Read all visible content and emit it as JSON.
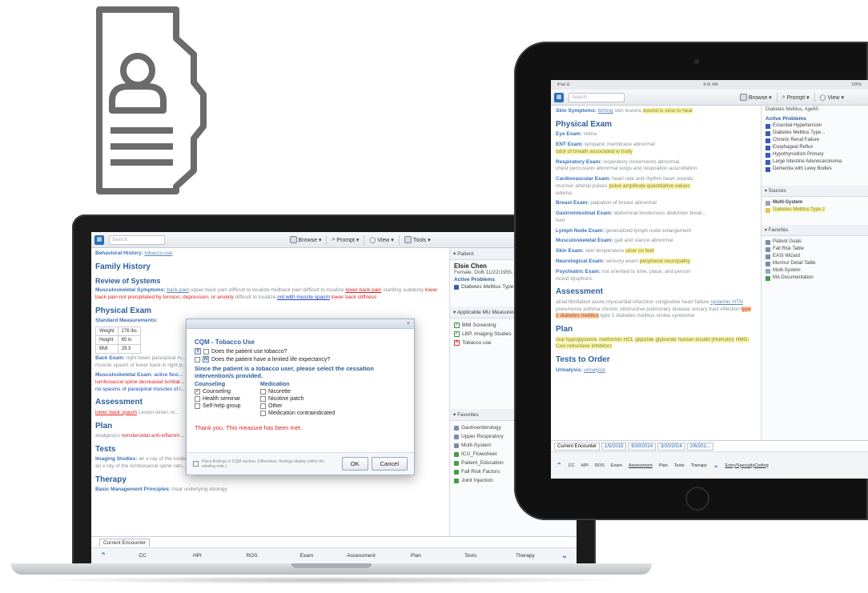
{
  "toolbar": {
    "search_placeholder": "Search",
    "browse": "Browse ▾",
    "prompt": "Prompt ▾",
    "view": "View ▾",
    "tools": "Tools ▾"
  },
  "laptop": {
    "behavioral_label": "Behavioral History:",
    "behavioral_value": "tobacco use",
    "family_history": "Family History",
    "review_of_systems": "Review of Systems",
    "ros_label": "Musculoskeletal Symptoms:",
    "ros_text_1": "back pain",
    "ros_text_2": "upper back pain difficult to localize",
    "ros_text_3": "midback pain difficult to localize",
    "ros_text_4": "lower back pain",
    "ros_text_5": "startling suddenly",
    "ros_text_6": "lower back pain not precipitated by tension, depression, or anxiety",
    "ros_text_7": "difficult to localize",
    "ros_text_8": "not with muscle spasm",
    "ros_text_9": "lower back stiffness",
    "physical_exam": "Physical Exam",
    "standard_measurements": "Standard Measurements:",
    "vitals": [
      {
        "label": "Weight",
        "value": "176 lbs"
      },
      {
        "label": "Height",
        "value": "65 in"
      },
      {
        "label": "BMI",
        "value": "29.3"
      }
    ],
    "back_exam_label": "Back Exam:",
    "back_exam_text": "right lower paraspinal m...",
    "back_exam_text2": "muscle spasm of lower back in right p...",
    "msk_label": "Musculoskeletal Exam:",
    "msk_text": "active flexi...",
    "msk_text2": "lumbosacral spine decreased lumbar...",
    "msk_text3": "no spasms of paraspinal muscles of l...",
    "assessment": "Assessment",
    "assessment_text": "lower back spasm",
    "assessment_text2": "Lesion strain, lo...",
    "plan": "Plan",
    "plan_text": "analgesics",
    "plan_text2": "nonsteroidal anti-inflamm...",
    "tests": "Tests",
    "imaging_label": "Imaging Studies:",
    "imaging_text": "an x-ray of the lumbosacral spine (AP, lateral, and oblique views)",
    "imaging_text2": "an x-ray of the lumbosacral spine can...",
    "therapy": "Therapy",
    "therapy_label": "Basic Management Principles:",
    "therapy_text": "treat underlying etiology",
    "tab_label": "Current Encounter",
    "nav": [
      "CC",
      "HPI",
      "ROS",
      "Exam",
      "Assessment",
      "Plan",
      "Tests",
      "Therapy"
    ],
    "right": {
      "patient_header": "▾ Patient",
      "patient_name": "Elsie Chen",
      "patient_info": "Female, DoB 11/22/1955, ...",
      "active_problems": "Active Problems",
      "problem_1": "Diabetes Mellitus Type...",
      "mu_header": "▾ Applicable MU Measures",
      "mu_items": [
        "BMI Screening",
        "LBP, Imaging Studies",
        "Tobacco use"
      ],
      "fav_header": "▾ Favorites",
      "favorites": [
        "Gastroenterology",
        "Upper Respiratory",
        "Multi-System",
        "ICU_Flowsheet",
        "Patient_Education",
        "Fall Risk Factors",
        "Joint Injection"
      ]
    }
  },
  "dialog": {
    "close": "×",
    "title": "CQM - Tobacco Use",
    "q1_answer": "Y",
    "q1": "Does the patient use tobacco?",
    "q2_answer": "N",
    "q2": "Does the patient have a limited life expectancy?",
    "instruction": "Since the patient is a tobacco user, please select the cessation intervention/s provided.",
    "counseling_header": "Counseling",
    "counseling": [
      {
        "label": "Counseling",
        "checked": true
      },
      {
        "label": "Health seminar",
        "checked": false
      },
      {
        "label": "Self-help group",
        "checked": false
      }
    ],
    "medication_header": "Medication",
    "medication": [
      {
        "label": "Nicorette",
        "checked": false
      },
      {
        "label": "Nicotine patch",
        "checked": false
      },
      {
        "label": "Other",
        "checked": false
      },
      {
        "label": "Medication contraindicated",
        "checked": false
      }
    ],
    "thanks": "Thank you. This measure has been met.",
    "placement_note": "Place findings in CQM section. (Otherwise, findings display within the existing note.)",
    "ok": "OK",
    "cancel": "Cancel"
  },
  "tablet": {
    "status_left": "iPad ☰",
    "status_mid": "9:41 AM",
    "status_right": "100%",
    "skin_symptoms_label": "Skin Symptoms:",
    "skin_symptoms_text": "itching",
    "skin_symptoms_text2": "skin lesions",
    "skin_symptoms_hl": "wound is slow to heal",
    "physical_exam": "Physical Exam",
    "eye_label": "Eye Exam:",
    "eye_text": "retina",
    "ent_label": "ENT Exam:",
    "ent_text": "tympanic membrane abnormal",
    "ent_hl": "odor of breath associated w fruity",
    "resp_label": "Respiratory Exam:",
    "resp_text": "respiratory movements abnormal",
    "resp_text2": "chest percussion abnormal",
    "resp_text3": "lungs and respiration auscultation",
    "cv_label": "Cardiovascular Exam:",
    "cv_text": "heart rate and rhythm",
    "cv_text2": "heart sounds",
    "cv_text3": "murmur",
    "cv_text4": "arterial pulses",
    "cv_hl": "pulse amplitude quantitative values",
    "cv_text5": "edema",
    "breast_label": "Breast Exam:",
    "breast_text": "palpation of breast abnormal",
    "gi_label": "Gastrointestinal Exam:",
    "gi_text": "abdominal tenderness",
    "gi_text2": "abdomen breat...",
    "gi_text3": "liver",
    "lymph_label": "Lymph Node Exam:",
    "lymph_text": "generalized lymph node enlargement",
    "msk_label": "Musculoskeletal Exam:",
    "msk_text": "gait and stance abnormal",
    "skin_label": "Skin Exam:",
    "skin_text": "skin temperature",
    "skin_hl": "ulcer on feet",
    "neuro_label": "Neurological Exam:",
    "neuro_text": "sensory exam",
    "neuro_hl": "peripheral neuropathy",
    "psych_label": "Psychiatric Exam:",
    "psych_text": "not oriented to time, place, and person",
    "psych_text2": "mood dysphoric",
    "assessment": "Assessment",
    "assess_text": "atrial fibrillation",
    "assess_text2": "acute myocardial infarction",
    "assess_text3": "congestive heart failure",
    "assess_text4": "systemic HTN",
    "assess_text5": "pneumonia",
    "assess_text6": "asthma",
    "assess_text7": "chronic obstructive pulmonary disease",
    "assess_text8": "urinary tract infection",
    "assess_hl": "type 2 diabetes mellitus",
    "assess_text9": "type 1 diabetes mellitus",
    "assess_text10": "stroke syndrome",
    "plan": "Plan",
    "plan_hl": "oral hypoglycemic",
    "plan_hl2": "metformin HCL",
    "plan_hl3": "glipizide",
    "plan_hl4": "glyburide",
    "plan_hl5": "human insulin (Humulin)",
    "plan_hl6": "HMG-CoA reductase inhibitors",
    "tests_to_order": "Tests to Order",
    "urinalysis_label": "Urinalysis:",
    "urinalysis_text": "urinalysis",
    "right": {
      "top_text": "Diabetes Mellitus, Age60",
      "active_problems": "Active Problems",
      "problems": [
        "Essential Hypertension",
        "Diabetes Mellitus Type...",
        "Chronic Renal Failure",
        "Esophageal Reflux",
        "Hypothyroidism Primary",
        "Large Intestine Adenocarcinoma",
        "Dementia with Lewy Bodies"
      ],
      "sources_header": "▾ Sources",
      "sources": [
        "Multi-System",
        "Diabetes Mellitus Type 2"
      ],
      "fav_header": "▾ Favorites",
      "favorites": [
        "Patient Goals",
        "Fall Risk Table",
        "EASI Wizard",
        "Murmur Detail Table",
        "Multi-System",
        "MA Documentation"
      ]
    },
    "tabs": [
      "Current Encounter",
      "1/5/2015",
      "6/30/2014",
      "3/20/2014",
      "2/6/201..."
    ],
    "nav": [
      "CC",
      "HPI",
      "ROS",
      "Exam",
      "Assessment",
      "Plan",
      "Tests",
      "Therapy"
    ],
    "nav_special": "Entry/SpecialtyCoding"
  }
}
